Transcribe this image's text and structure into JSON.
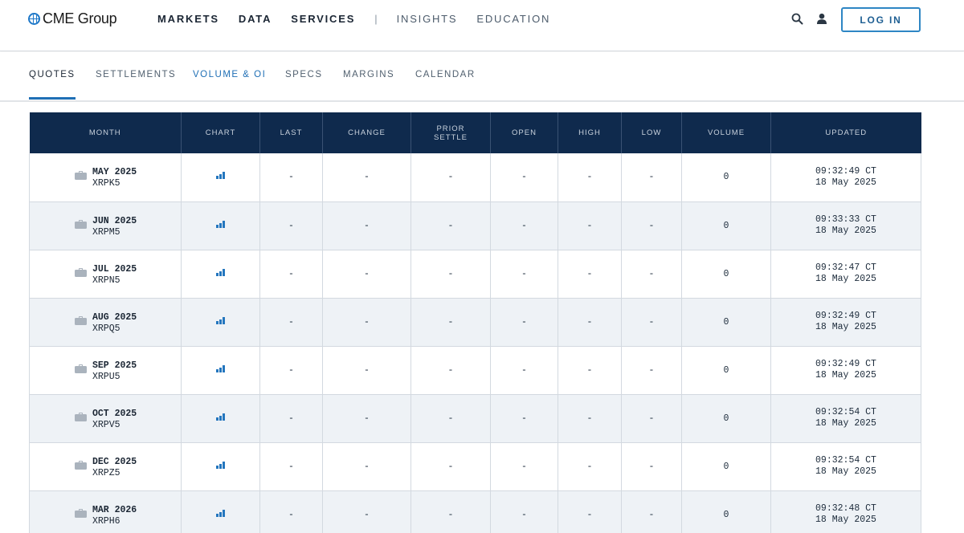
{
  "brand": {
    "logo_text": "CME Group"
  },
  "nav": {
    "items": [
      {
        "label": "MARKETS",
        "style": "strong"
      },
      {
        "label": "DATA",
        "style": "strong"
      },
      {
        "label": "SERVICES",
        "style": "strong"
      },
      {
        "label": "INSIGHTS",
        "style": "light"
      },
      {
        "label": "EDUCATION",
        "style": "light"
      }
    ],
    "separator": "|",
    "login_label": "LOG IN"
  },
  "tabs": [
    {
      "label": "QUOTES",
      "state": "active"
    },
    {
      "label": "SETTLEMENTS",
      "state": "normal"
    },
    {
      "label": "VOLUME & OI",
      "state": "highlight"
    },
    {
      "label": "SPECS",
      "state": "normal"
    },
    {
      "label": "MARGINS",
      "state": "normal"
    },
    {
      "label": "CALENDAR",
      "state": "normal"
    }
  ],
  "table": {
    "headers": [
      "MONTH",
      "CHART",
      "LAST",
      "CHANGE",
      "PRIOR SETTLE",
      "OPEN",
      "HIGH",
      "LOW",
      "VOLUME",
      "UPDATED"
    ],
    "rows": [
      {
        "month": "MAY 2025",
        "code": "XRPK5",
        "last": "-",
        "change": "-",
        "prior_settle": "-",
        "open": "-",
        "high": "-",
        "low": "-",
        "volume": "0",
        "time": "09:32:49 CT",
        "date": "18 May 2025"
      },
      {
        "month": "JUN 2025",
        "code": "XRPM5",
        "last": "-",
        "change": "-",
        "prior_settle": "-",
        "open": "-",
        "high": "-",
        "low": "-",
        "volume": "0",
        "time": "09:33:33 CT",
        "date": "18 May 2025"
      },
      {
        "month": "JUL 2025",
        "code": "XRPN5",
        "last": "-",
        "change": "-",
        "prior_settle": "-",
        "open": "-",
        "high": "-",
        "low": "-",
        "volume": "0",
        "time": "09:32:47 CT",
        "date": "18 May 2025"
      },
      {
        "month": "AUG 2025",
        "code": "XRPQ5",
        "last": "-",
        "change": "-",
        "prior_settle": "-",
        "open": "-",
        "high": "-",
        "low": "-",
        "volume": "0",
        "time": "09:32:49 CT",
        "date": "18 May 2025"
      },
      {
        "month": "SEP 2025",
        "code": "XRPU5",
        "last": "-",
        "change": "-",
        "prior_settle": "-",
        "open": "-",
        "high": "-",
        "low": "-",
        "volume": "0",
        "time": "09:32:49 CT",
        "date": "18 May 2025"
      },
      {
        "month": "OCT 2025",
        "code": "XRPV5",
        "last": "-",
        "change": "-",
        "prior_settle": "-",
        "open": "-",
        "high": "-",
        "low": "-",
        "volume": "0",
        "time": "09:32:54 CT",
        "date": "18 May 2025"
      },
      {
        "month": "DEC 2025",
        "code": "XRPZ5",
        "last": "-",
        "change": "-",
        "prior_settle": "-",
        "open": "-",
        "high": "-",
        "low": "-",
        "volume": "0",
        "time": "09:32:54 CT",
        "date": "18 May 2025"
      },
      {
        "month": "MAR 2026",
        "code": "XRPH6",
        "last": "-",
        "change": "-",
        "prior_settle": "-",
        "open": "-",
        "high": "-",
        "low": "-",
        "volume": "0",
        "time": "09:32:48 CT",
        "date": "18 May 2025"
      }
    ]
  },
  "icons": {
    "search": "search-icon",
    "user": "user-icon",
    "row_icon": "briefcase-icon",
    "chart": "bar-chart-icon"
  },
  "colors": {
    "header_bg": "#0f2a4d",
    "accent_blue": "#1f6fb5",
    "alt_row": "#eef2f6"
  }
}
